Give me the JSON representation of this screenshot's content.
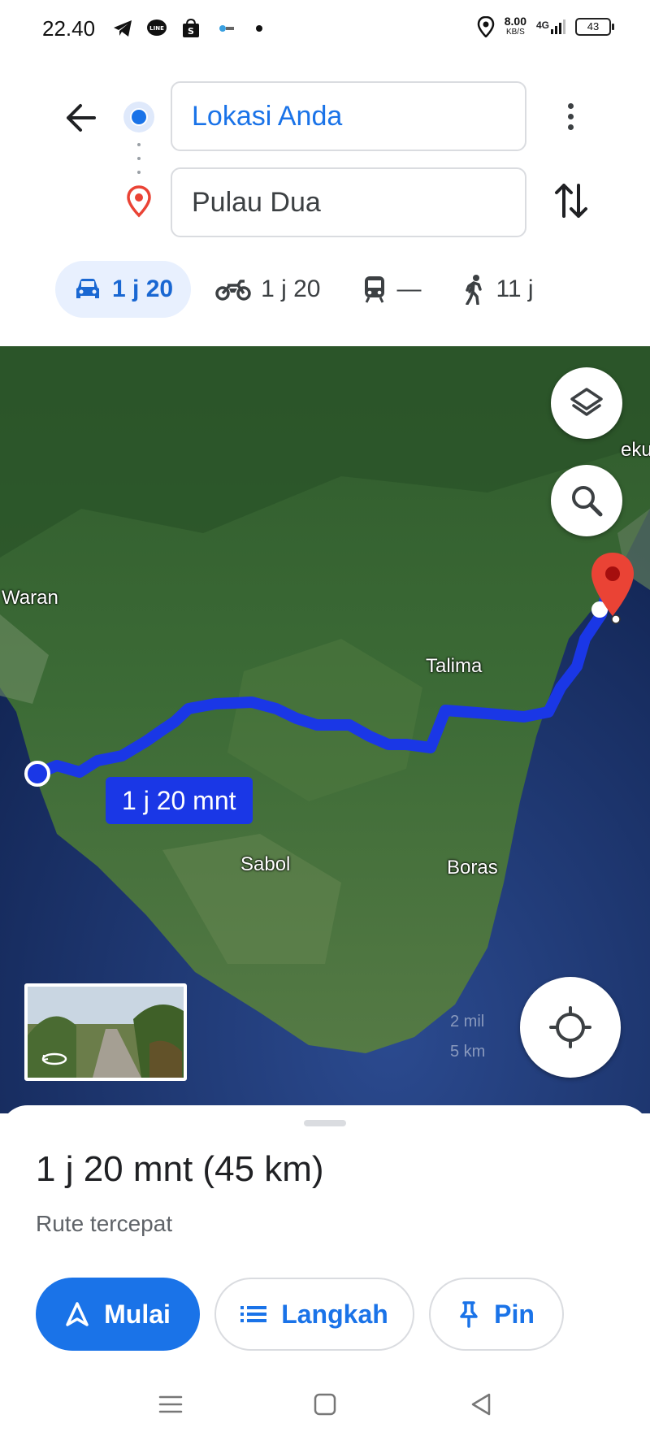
{
  "status_bar": {
    "time": "22.40",
    "network_speed": "8.00",
    "network_speed_unit": "KB/S",
    "network_type": "4G",
    "battery": "43"
  },
  "directions": {
    "origin": "Lokasi Anda",
    "destination": "Pulau Dua"
  },
  "travel_modes": [
    {
      "mode": "car",
      "icon": "car-icon",
      "time": "1 j 20",
      "selected": true
    },
    {
      "mode": "motorcycle",
      "icon": "motorcycle-icon",
      "time": "1 j 20",
      "selected": false
    },
    {
      "mode": "transit",
      "icon": "train-icon",
      "time": "—",
      "selected": false
    },
    {
      "mode": "walk",
      "icon": "walk-icon",
      "time": "11 j",
      "selected": false
    }
  ],
  "map": {
    "place_labels": [
      "Waran",
      "Talima",
      "Sabol",
      "Boras",
      "eku"
    ],
    "route_badge": "1 j 20 mnt",
    "route_color": "#1a37e6",
    "scale_mi": "2 mil",
    "scale_km": "5 km"
  },
  "route_summary": {
    "duration_distance": "1 j 20 mnt (45 km)",
    "description": "Rute tercepat"
  },
  "buttons": {
    "start": "Mulai",
    "steps": "Langkah",
    "pin": "Pin"
  },
  "colors": {
    "accent": "#1a73e8",
    "destination_marker": "#ea4335"
  }
}
